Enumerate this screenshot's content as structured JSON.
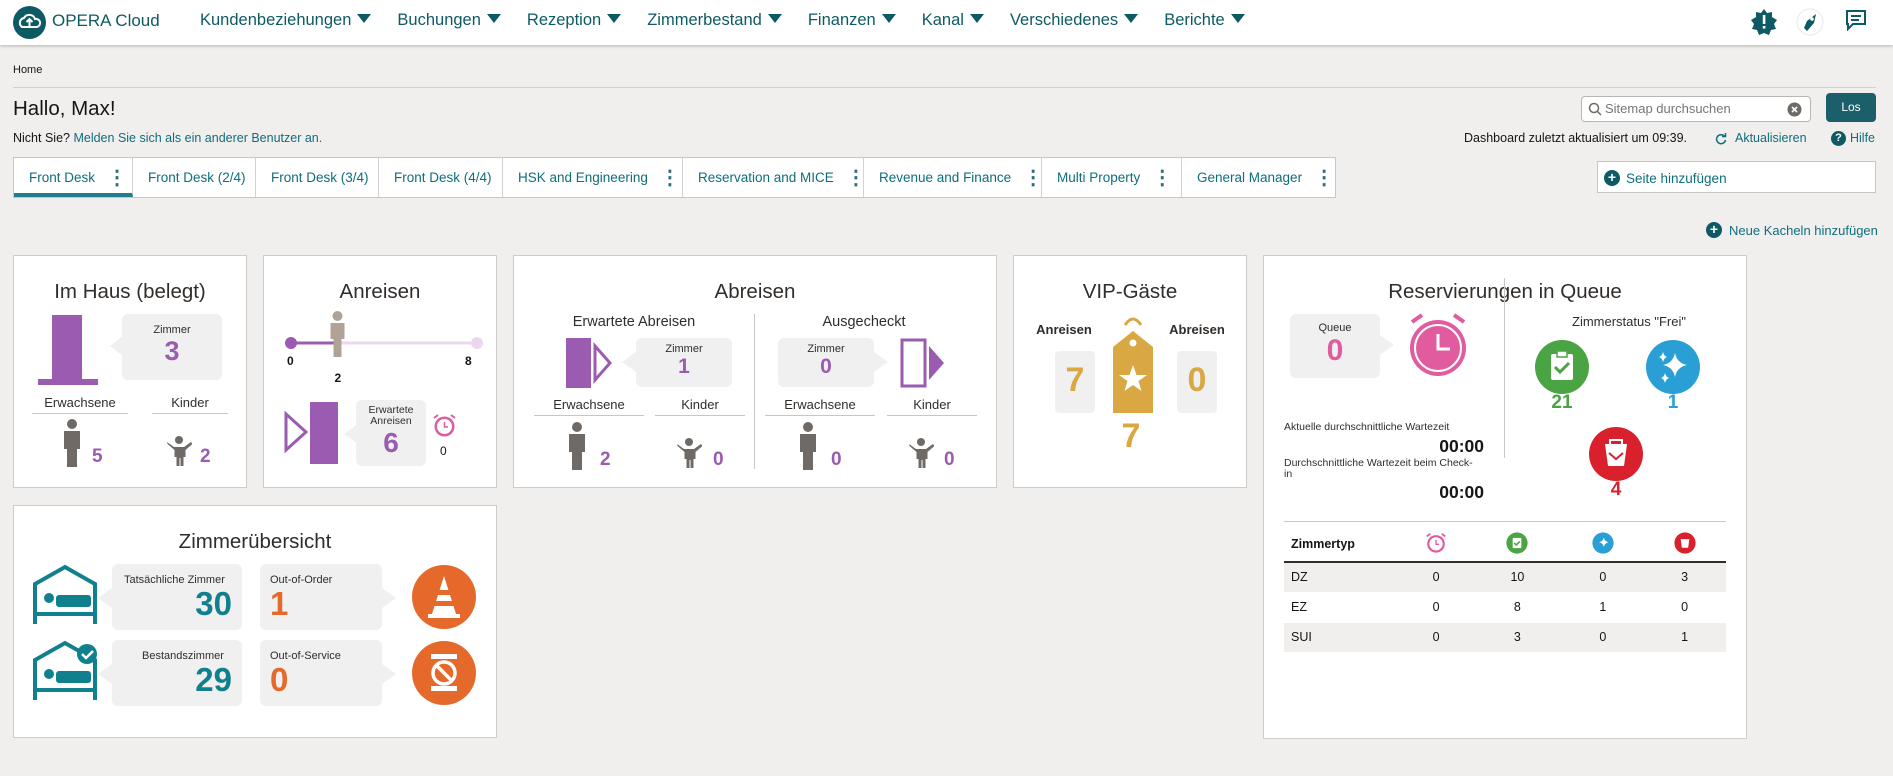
{
  "app": {
    "brand": "OPERA Cloud"
  },
  "nav": {
    "items": [
      "Kundenbeziehungen",
      "Buchungen",
      "Rezeption",
      "Zimmerbestand",
      "Finanzen",
      "Kanal",
      "Verschiedenes",
      "Berichte"
    ]
  },
  "breadcrumb": "Home",
  "greeting": "Hallo, Max!",
  "not_you": {
    "prefix": "Nicht Sie?",
    "link": "Melden Sie sich als ein anderer Benutzer an."
  },
  "search": {
    "placeholder": "Sitemap durchsuchen",
    "button": "Los"
  },
  "dashboard": {
    "updated": "Dashboard zuletzt aktualisiert um 09:39.",
    "refresh": "Aktualisieren",
    "help": "Hilfe"
  },
  "tabs": [
    "Front Desk",
    "Front Desk (2/4)",
    "Front Desk (3/4)",
    "Front Desk (4/4)",
    "HSK and Engineering",
    "Reservation and MICE",
    "Revenue and Finance",
    "Multi Property",
    "General Manager"
  ],
  "add_page": "Seite hinzufügen",
  "add_tiles": "Neue Kacheln hinzufügen",
  "im_haus": {
    "title": "Im Haus (belegt)",
    "rooms_label": "Zimmer",
    "rooms": "3",
    "adults_label": "Erwachsene",
    "adults": "5",
    "children_label": "Kinder",
    "children": "2"
  },
  "anreisen": {
    "title": "Anreisen",
    "min": "0",
    "max": "8",
    "current": "2",
    "progress": 0.25,
    "expected_label": "Erwartete Anreisen",
    "expected": "6",
    "late": "0"
  },
  "abreisen": {
    "title": "Abreisen",
    "expected_title": "Erwartete Abreisen",
    "checked_out_title": "Ausgecheckt",
    "rooms_label": "Zimmer",
    "expected_rooms": "1",
    "checked_rooms": "0",
    "adults_label": "Erwachsene",
    "children_label": "Kinder",
    "exp_adults": "2",
    "exp_children": "0",
    "co_adults": "0",
    "co_children": "0"
  },
  "vip": {
    "title": "VIP-Gäste",
    "arrivals_label": "Anreisen",
    "departures_label": "Abreisen",
    "arrivals": "7",
    "departures": "0",
    "total": "7"
  },
  "queue": {
    "title": "Reservierungen in Queue",
    "queue_label": "Queue",
    "queue": "0",
    "room_status_title": "Zimmerstatus \"Frei\"",
    "inspected": "21",
    "clean": "1",
    "dirty": "4",
    "wait_label": "Aktuelle durchschnittliche Wartezeit",
    "wait": "00:00",
    "checkin_wait_label": "Durchschnittliche Wartezeit beim Check-in",
    "checkin_wait": "00:00",
    "table": {
      "header": "Zimmertyp",
      "rows": [
        [
          "DZ",
          "0",
          "10",
          "0",
          "3"
        ],
        [
          "EZ",
          "0",
          "8",
          "1",
          "0"
        ],
        [
          "SUI",
          "0",
          "3",
          "0",
          "1"
        ]
      ]
    }
  },
  "zimmer": {
    "title": "Zimmerübersicht",
    "actual_label": "Tatsächliche Zimmer",
    "actual": "30",
    "ooo_label": "Out-of-Order",
    "ooo": "1",
    "inventory_label": "Bestandszimmer",
    "inventory": "29",
    "oos_label": "Out-of-Service",
    "oos": "0"
  },
  "colors": {
    "teal": "#0e5a64",
    "purple": "#9a5bb0",
    "orange": "#e4692a",
    "gold": "#d9a843",
    "pink": "#e05c9f",
    "green": "#4aa443",
    "blue": "#2a9fd6",
    "red": "#d9212e"
  }
}
